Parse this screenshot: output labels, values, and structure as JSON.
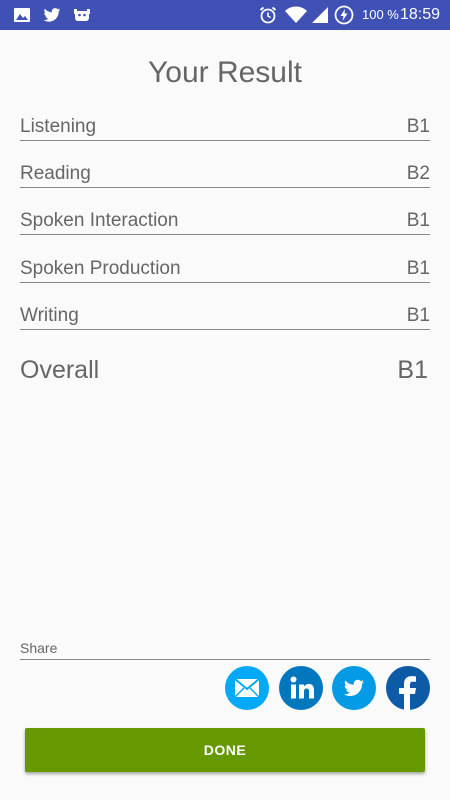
{
  "status_bar": {
    "battery_text": "100 %",
    "time": "18:59",
    "left_icons": [
      "image-icon",
      "twitter-icon",
      "android-debug-icon"
    ],
    "right_icons": [
      "alarm-icon",
      "wifi-icon",
      "signal-icon",
      "battery-saver-icon"
    ]
  },
  "title": "Your Result",
  "results": [
    {
      "label": "Listening",
      "value": "B1"
    },
    {
      "label": "Reading",
      "value": "B2"
    },
    {
      "label": "Spoken Interaction",
      "value": "B1"
    },
    {
      "label": "Spoken Production",
      "value": "B1"
    },
    {
      "label": "Writing",
      "value": "B1"
    }
  ],
  "overall": {
    "label": "Overall",
    "value": "B1"
  },
  "share": {
    "label": "Share",
    "buttons": [
      {
        "name": "email-share-button",
        "icon": "email-icon",
        "color": "#03a9f4"
      },
      {
        "name": "linkedin-share-button",
        "icon": "linkedin-icon",
        "color": "#0277bd"
      },
      {
        "name": "twitter-share-button",
        "icon": "twitter-icon",
        "color": "#039be5"
      },
      {
        "name": "facebook-share-button",
        "icon": "facebook-icon",
        "color": "#0d5aa7"
      }
    ]
  },
  "done_label": "DONE",
  "colors": {
    "status_bar": "#3f51b5",
    "background": "#fafafa",
    "text": "#666666",
    "done_button": "#669900"
  }
}
